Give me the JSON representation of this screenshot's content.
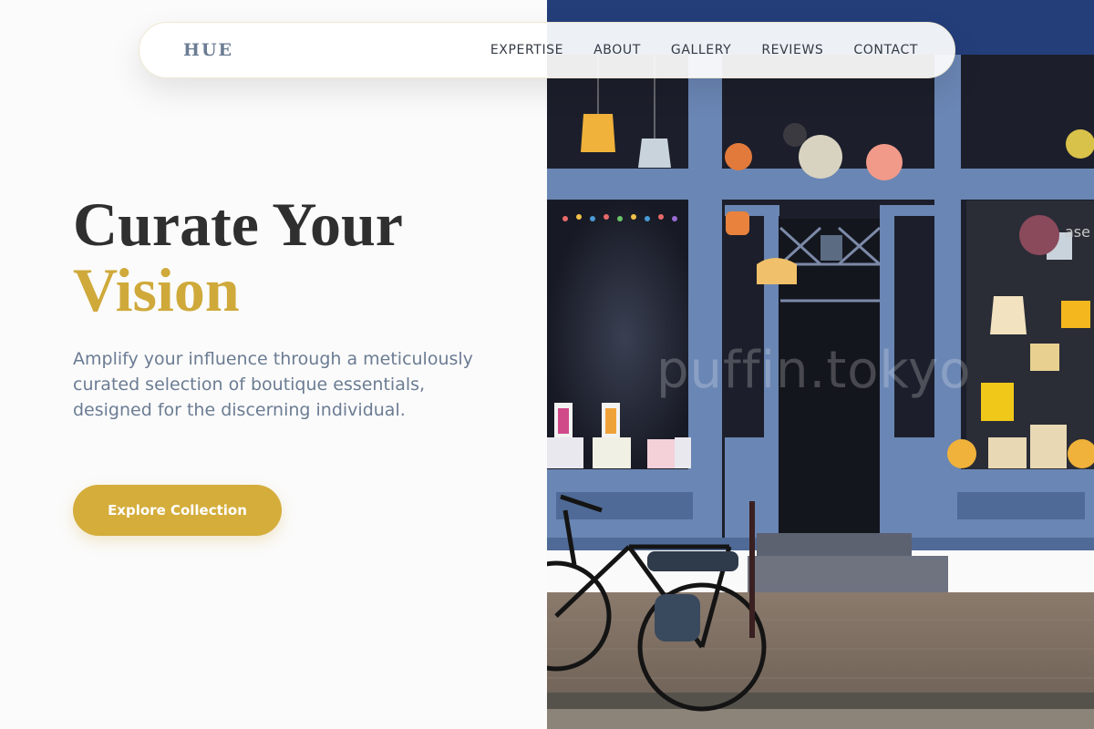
{
  "nav": {
    "logo": "HUE",
    "links": [
      "EXPERTISE",
      "ABOUT",
      "GALLERY",
      "REVIEWS",
      "CONTACT"
    ]
  },
  "hero": {
    "title_line1": "Curate Your",
    "title_line2": "Vision",
    "description": "Amplify your influence through a meticulously curated selection of boutique essentials, designed for the discerning individual.",
    "cta_label": "Explore Collection"
  },
  "image": {
    "watermark": "puffin.tokyo",
    "sign_text": "ase"
  },
  "colors": {
    "accent": "#d4ad3b",
    "heading": "#2f2f2f",
    "body_text": "#6b7c93",
    "frame_blue": "#6a86b4"
  }
}
